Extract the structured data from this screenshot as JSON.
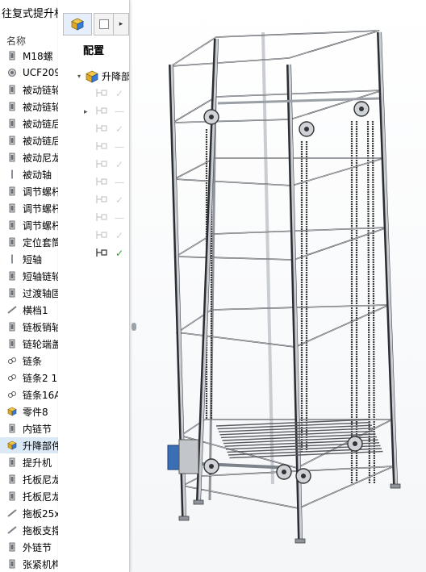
{
  "tree": {
    "title": "往复式提升机",
    "header": "名称",
    "items": [
      {
        "label": "M18螺",
        "icon": "part-icon"
      },
      {
        "label": "UCF209",
        "icon": "bearing-icon"
      },
      {
        "label": "被动链轮",
        "icon": "part-icon"
      },
      {
        "label": "被动链轮",
        "icon": "part-icon"
      },
      {
        "label": "被动链后",
        "icon": "part-icon"
      },
      {
        "label": "被动链后",
        "icon": "part-icon"
      },
      {
        "label": "被动尼龙",
        "icon": "part-icon"
      },
      {
        "label": "被动轴",
        "icon": "shaft-icon"
      },
      {
        "label": "调节螺杆",
        "icon": "part-icon"
      },
      {
        "label": "调节螺杆",
        "icon": "part-icon"
      },
      {
        "label": "调节螺杆",
        "icon": "part-icon"
      },
      {
        "label": "定位套筒",
        "icon": "part-icon"
      },
      {
        "label": "短轴",
        "icon": "shaft-icon"
      },
      {
        "label": "短轴链轮",
        "icon": "part-icon"
      },
      {
        "label": "过渡轴固",
        "icon": "part-icon"
      },
      {
        "label": "横档1",
        "icon": "beam-icon"
      },
      {
        "label": "链板销轴",
        "icon": "part-icon"
      },
      {
        "label": "链轮端盖",
        "icon": "part-icon"
      },
      {
        "label": "链条",
        "icon": "chain-icon"
      },
      {
        "label": "链条2 1",
        "icon": "chain-icon"
      },
      {
        "label": "链条16A",
        "icon": "chain-icon"
      },
      {
        "label": "零件8",
        "icon": "assembly-icon"
      },
      {
        "label": "内链节",
        "icon": "part-icon"
      },
      {
        "label": "升降部件",
        "icon": "assembly-icon",
        "selected": true
      },
      {
        "label": "提升机",
        "icon": "part-icon"
      },
      {
        "label": "托板尼龙",
        "icon": "part-icon"
      },
      {
        "label": "托板尼龙",
        "icon": "part-icon"
      },
      {
        "label": "拖板25x",
        "icon": "beam-icon"
      },
      {
        "label": "拖板支撑",
        "icon": "beam-icon"
      },
      {
        "label": "外链节",
        "icon": "part-icon"
      },
      {
        "label": "张紧机构",
        "icon": "part-icon"
      }
    ]
  },
  "config": {
    "title": "配置",
    "root_label": "升降部件",
    "rows": [
      {
        "state": "inactive"
      },
      {
        "state": "inactive"
      },
      {
        "state": "inactive"
      },
      {
        "state": "inactive"
      },
      {
        "state": "inactive"
      },
      {
        "state": "inactive"
      },
      {
        "state": "inactive"
      },
      {
        "state": "inactive"
      },
      {
        "state": "inactive"
      },
      {
        "state": "active"
      }
    ]
  },
  "viewport": {
    "model": "lift-tower",
    "frame_color": "#2b2f33",
    "beam_color": "#c9cdd2",
    "chain_color": "#3a3a3a",
    "motor_color": "#3b6fb5"
  }
}
